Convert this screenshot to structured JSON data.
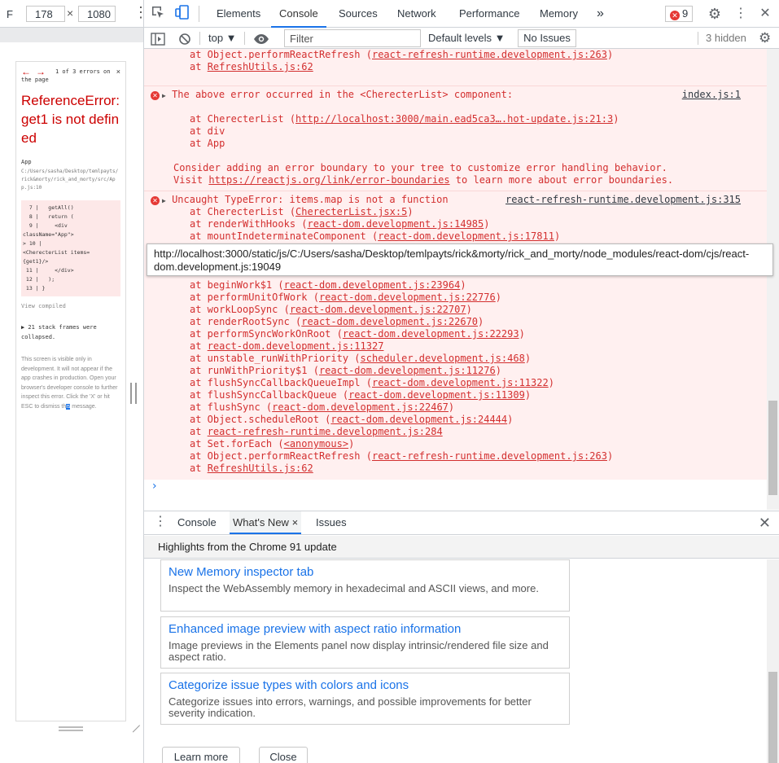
{
  "device": {
    "label": "F",
    "width": "178",
    "height": "1080",
    "times": "×",
    "kebab": "⋮",
    "screen": {
      "error_count": "1 of 3 errors on",
      "on_page": "the page",
      "close": "×",
      "prev": "←",
      "next": "→",
      "error_title": "ReferenceError: get1 is not defined",
      "app": "App",
      "path": "C:/Users/sasha/Desktop/temlpayts/rick&morty/rick_and_morty/src/App.js:10",
      "code": "  7 |   getAll()\n  8 |   return (\n  9 |     <div\nclassName=\"App\">\n> 10 |\n<CherecterList items=\n{get1}/>\n 11 |     </div>\n 12 |   );\n 13 | }",
      "view_compiled": "View compiled",
      "frames": "▶ 21 stack frames were collapsed.",
      "note_before": "This screen is visible only in development. It will not appear if the app crashes in production. Open your browser's developer console to further inspect this error.  Click the 'X' or hit ESC to dismiss th",
      "note_highlight": "is",
      "note_after": " message."
    }
  },
  "tabs": {
    "elements": "Elements",
    "console": "Console",
    "sources": "Sources",
    "network": "Network",
    "performance": "Performance",
    "memory": "Memory",
    "more": "»",
    "errors": "9",
    "gear": "⚙",
    "kebab": "⋮",
    "close": "✕"
  },
  "toolbar": {
    "context": "top ▼",
    "filter_placeholder": "Filter",
    "levels": "Default levels ▼",
    "no_issues": "No Issues",
    "hidden": "3 hidden"
  },
  "log": {
    "b0": [
      "at Object.performReactRefresh (react-refresh-runtime.development.js:263)",
      "at RefreshUtils.js:62"
    ],
    "b1_head": "The above error occurred in the <CherecterList> component:",
    "b1_src": "index.js:1",
    "b1_stack": [
      "at CherecterList (http://localhost:3000/main.ead5ca3….hot-update.js:21:3)",
      "at div",
      "at App"
    ],
    "b1_tail": [
      "Consider adding an error boundary to your tree to customize error handling behavior.",
      "Visit https://reactjs.org/link/error-boundaries to learn more about error boundaries."
    ],
    "b2_head": "Uncaught TypeError: items.map is not a function",
    "b2_src": "react-refresh-runtime.development.js:315",
    "b2_stack_a": [
      "at CherecterList (CherecterList.jsx:5)",
      "at renderWithHooks (react-dom.development.js:14985)",
      "at mountIndeterminateComponent (react-dom.development.js:17811)",
      "at beginWork (react-dom.development.js:19049)"
    ],
    "b2_stack_b": [
      "at beginWork$1 (react-dom.development.js:23964)",
      "at performUnitOfWork (react-dom.development.js:22776)",
      "at workLoopSync (react-dom.development.js:22707)",
      "at renderRootSync (react-dom.development.js:22670)",
      "at performSyncWorkOnRoot (react-dom.development.js:22293)",
      "at react-dom.development.js:11327",
      "at unstable_runWithPriority (scheduler.development.js:468)",
      "at runWithPriority$1 (react-dom.development.js:11276)",
      "at flushSyncCallbackQueueImpl (react-dom.development.js:11322)",
      "at flushSyncCallbackQueue (react-dom.development.js:11309)",
      "at flushSync (react-dom.development.js:22467)",
      "at Object.scheduleRoot (react-dom.development.js:24444)",
      "at react-refresh-runtime.development.js:284",
      "at Set.forEach (<anonymous>)",
      "at Object.performReactRefresh (react-refresh-runtime.development.js:263)",
      "at RefreshUtils.js:62"
    ],
    "prompt": "›",
    "tooltip": "http://localhost:3000/static/js/C:/Users/sasha/Desktop/temlpayts/rick&morty/rick_and_morty/node_modules/react-dom/cjs/react-dom.development.js:19049"
  },
  "drawer": {
    "tab_console": "Console",
    "tab_whats_new": "What's New",
    "tab_close": "×",
    "tab_issues": "Issues",
    "close": "✕",
    "kebab": "⋮",
    "header": "Highlights from the Chrome 91 update",
    "cards": [
      {
        "title": "New Memory inspector tab",
        "desc": "Inspect the WebAssembly memory in hexadecimal and ASCII views, and more."
      },
      {
        "title": "Enhanced image preview with aspect ratio information",
        "desc": "Image previews in the Elements panel now display intrinsic/rendered file size and aspect ratio."
      },
      {
        "title": "Categorize issue types with colors and icons",
        "desc": "Categorize issues into errors, warnings, and possible improvements for better severity indication."
      }
    ],
    "learn_more": "Learn more",
    "close_btn": "Close"
  },
  "colors": {
    "accent": "#1a73e8",
    "error_text": "#d32f2f",
    "error_bg": "#fff0f0"
  },
  "icons": [
    "inspect-icon",
    "device-toggle-icon",
    "sidebar-toggle-icon",
    "clear-console-icon",
    "eye-icon",
    "gear-icon",
    "error-icon",
    "expand-triangle-icon"
  ]
}
